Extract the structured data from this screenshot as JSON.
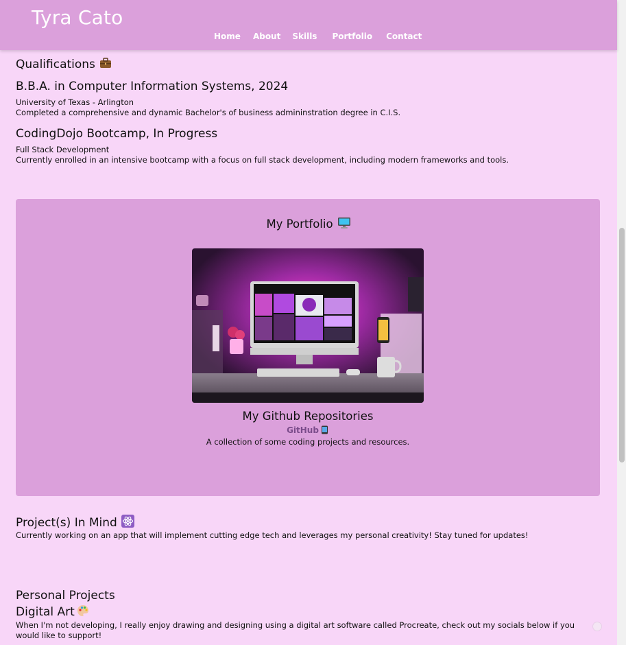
{
  "header": {
    "brand": "Tyra Cato",
    "nav": [
      "Home",
      "About",
      "Skills",
      "Portfolio",
      "Contact"
    ]
  },
  "qualifications": {
    "title": "Qualifications",
    "title_icon": "briefcase-icon",
    "items": [
      {
        "degree": "B.B.A. in Computer Information Systems, 2024",
        "school": "University of Texas - Arlington",
        "desc": "Completed a comprehensive and dynamic Bachelor's of business admininstration degree in C.I.S."
      },
      {
        "degree": "CodingDojo Bootcamp, In Progress",
        "school": "Full Stack Development",
        "desc": "Currently enrolled in an intensive bootcamp with a focus on full stack development, including modern frameworks and tools."
      }
    ]
  },
  "portfolio": {
    "title": "My Portfolio",
    "title_icon": "computer-icon",
    "image": "purple desk setup with monitor",
    "repo_title": "My Github Repositories",
    "github_label": "GitHub",
    "github_icon": "tablet-icon",
    "desc": "A collection of some coding projects and resources."
  },
  "projects_in_mind": {
    "title": "Project(s) In Mind",
    "title_icon": "atom-icon",
    "desc": "Currently working on an app that will implement cutting edge tech and leverages my personal creativity! Stay tuned for updates!"
  },
  "personal_projects": {
    "title": "Personal Projects",
    "sub_title": "Digital Art",
    "sub_icon": "palette-icon",
    "desc": "When I'm not developing, I really enjoy drawing and designing using a digital art software called Procreate, check out my socials below if you would like to support!"
  },
  "colors": {
    "header_bg": "#dba0db",
    "page_bg": "#f8d6f8",
    "panel_bg": "#dba0db"
  }
}
